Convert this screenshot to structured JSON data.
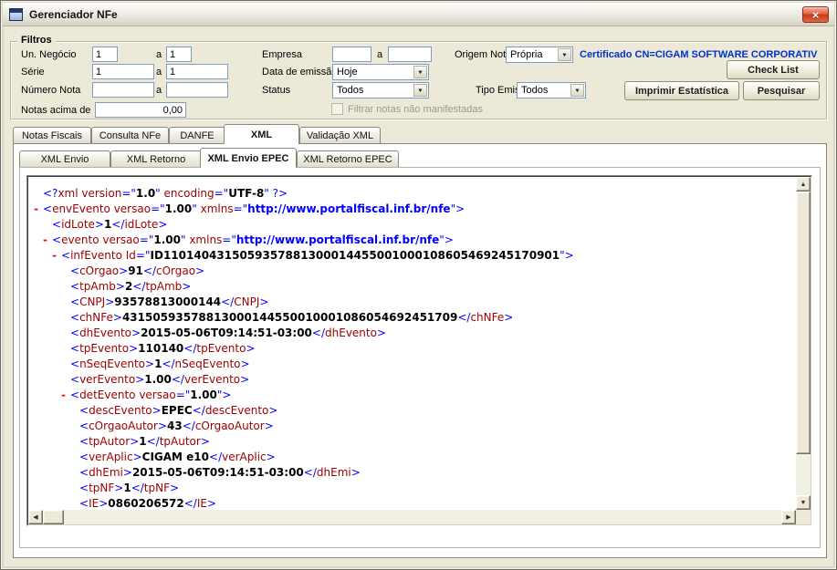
{
  "window": {
    "title": "Gerenciador NFe"
  },
  "icons": {
    "close": "×",
    "dropdown": "▼",
    "scroll_up": "▲",
    "scroll_down": "▼",
    "scroll_left": "◀",
    "scroll_right": "▶",
    "collapse": "-"
  },
  "colors": {
    "certificate_text": "#0033cc",
    "xml_markup": "#0000ff",
    "xml_tag": "#990000",
    "xml_text": "#000000",
    "xml_url": "#0000ff",
    "xml_marker": "#ff0000"
  },
  "filters": {
    "group_label": "Filtros",
    "range_sep": "a",
    "un_negocio_label": "Un. Negócio",
    "un_negocio_from": "1",
    "un_negocio_to": "1",
    "serie_label": "Série",
    "serie_from": "1",
    "serie_to": "1",
    "numero_label": "Número Nota",
    "numero_from": "",
    "numero_to": "",
    "notas_acima_label": "Notas acima de",
    "notas_acima_value": "0,00",
    "empresa_label": "Empresa",
    "empresa_from": "",
    "empresa_to": "",
    "data_emissao_label": "Data de emissão",
    "data_emissao_value": "Hoje",
    "status_label": "Status",
    "status_value": "Todos",
    "origem_label": "Origem Nota",
    "origem_value": "Própria",
    "tipo_emissao_label": "Tipo Emissão",
    "tipo_emissao_value": "Todos",
    "certificate_text": "Certificado CN=CIGAM SOFTWARE CORPORATIV",
    "manifest_checkbox_label": "Filtrar notas não manifestadas",
    "check_list_button": "Check List",
    "imprimir_button": "Imprimir Estatística",
    "pesquisar_button": "Pesquisar"
  },
  "tabs": {
    "main": [
      {
        "label": "Notas Fiscais"
      },
      {
        "label": "Consulta NFe"
      },
      {
        "label": "DANFE"
      },
      {
        "label": "XML",
        "active": true
      },
      {
        "label": "Validação XML"
      }
    ],
    "inner": [
      {
        "label": "XML Envio"
      },
      {
        "label": "XML Retorno"
      },
      {
        "label": "XML Envio EPEC",
        "active": true
      },
      {
        "label": "XML Retorno EPEC"
      }
    ]
  },
  "xml_viewer": {
    "lines": [
      {
        "lvl": 0,
        "mark": false,
        "seg": [
          [
            "m",
            "<?"
          ],
          [
            "t",
            "xml"
          ],
          [
            "t",
            " version"
          ],
          [
            "m",
            "=\""
          ],
          [
            "x",
            "1.0"
          ],
          [
            "m",
            "\""
          ],
          [
            "t",
            " encoding"
          ],
          [
            "m",
            "=\""
          ],
          [
            "x",
            "UTF-8"
          ],
          [
            "m",
            "\""
          ],
          [
            "m",
            " ?>"
          ]
        ]
      },
      {
        "lvl": 0,
        "mark": true,
        "seg": [
          [
            "m",
            "<"
          ],
          [
            "t",
            "envEvento"
          ],
          [
            "t",
            " versao"
          ],
          [
            "m",
            "=\""
          ],
          [
            "x",
            "1.00"
          ],
          [
            "m",
            "\""
          ],
          [
            "t",
            " xmlns"
          ],
          [
            "m",
            "=\""
          ],
          [
            "u",
            "http://www.portalfiscal.inf.br/nfe"
          ],
          [
            "m",
            "\""
          ],
          [
            "m",
            ">"
          ]
        ]
      },
      {
        "lvl": 1,
        "mark": false,
        "seg": [
          [
            "m",
            "<"
          ],
          [
            "t",
            "idLote"
          ],
          [
            "m",
            ">"
          ],
          [
            "x",
            "1"
          ],
          [
            "m",
            "</"
          ],
          [
            "t",
            "idLote"
          ],
          [
            "m",
            ">"
          ]
        ]
      },
      {
        "lvl": 1,
        "mark": true,
        "seg": [
          [
            "m",
            "<"
          ],
          [
            "t",
            "evento"
          ],
          [
            "t",
            " versao"
          ],
          [
            "m",
            "=\""
          ],
          [
            "x",
            "1.00"
          ],
          [
            "m",
            "\""
          ],
          [
            "t",
            " xmlns"
          ],
          [
            "m",
            "=\""
          ],
          [
            "u",
            "http://www.portalfiscal.inf.br/nfe"
          ],
          [
            "m",
            "\""
          ],
          [
            "m",
            ">"
          ]
        ]
      },
      {
        "lvl": 2,
        "mark": true,
        "seg": [
          [
            "m",
            "<"
          ],
          [
            "t",
            "infEvento"
          ],
          [
            "t",
            " Id"
          ],
          [
            "m",
            "=\""
          ],
          [
            "x",
            "ID1101404315059357881300014455001000108605469245170901"
          ],
          [
            "m",
            "\""
          ],
          [
            "m",
            ">"
          ]
        ]
      },
      {
        "lvl": 3,
        "mark": false,
        "seg": [
          [
            "m",
            "<"
          ],
          [
            "t",
            "cOrgao"
          ],
          [
            "m",
            ">"
          ],
          [
            "x",
            "91"
          ],
          [
            "m",
            "</"
          ],
          [
            "t",
            "cOrgao"
          ],
          [
            "m",
            ">"
          ]
        ]
      },
      {
        "lvl": 3,
        "mark": false,
        "seg": [
          [
            "m",
            "<"
          ],
          [
            "t",
            "tpAmb"
          ],
          [
            "m",
            ">"
          ],
          [
            "x",
            "2"
          ],
          [
            "m",
            "</"
          ],
          [
            "t",
            "tpAmb"
          ],
          [
            "m",
            ">"
          ]
        ]
      },
      {
        "lvl": 3,
        "mark": false,
        "seg": [
          [
            "m",
            "<"
          ],
          [
            "t",
            "CNPJ"
          ],
          [
            "m",
            ">"
          ],
          [
            "x",
            "93578813000144"
          ],
          [
            "m",
            "</"
          ],
          [
            "t",
            "CNPJ"
          ],
          [
            "m",
            ">"
          ]
        ]
      },
      {
        "lvl": 3,
        "mark": false,
        "seg": [
          [
            "m",
            "<"
          ],
          [
            "t",
            "chNFe"
          ],
          [
            "m",
            ">"
          ],
          [
            "x",
            "43150593578813000144550010001086054692451709"
          ],
          [
            "m",
            "</"
          ],
          [
            "t",
            "chNFe"
          ],
          [
            "m",
            ">"
          ]
        ]
      },
      {
        "lvl": 3,
        "mark": false,
        "seg": [
          [
            "m",
            "<"
          ],
          [
            "t",
            "dhEvento"
          ],
          [
            "m",
            ">"
          ],
          [
            "x",
            "2015-05-06T09:14:51-03:00"
          ],
          [
            "m",
            "</"
          ],
          [
            "t",
            "dhEvento"
          ],
          [
            "m",
            ">"
          ]
        ]
      },
      {
        "lvl": 3,
        "mark": false,
        "seg": [
          [
            "m",
            "<"
          ],
          [
            "t",
            "tpEvento"
          ],
          [
            "m",
            ">"
          ],
          [
            "x",
            "110140"
          ],
          [
            "m",
            "</"
          ],
          [
            "t",
            "tpEvento"
          ],
          [
            "m",
            ">"
          ]
        ]
      },
      {
        "lvl": 3,
        "mark": false,
        "seg": [
          [
            "m",
            "<"
          ],
          [
            "t",
            "nSeqEvento"
          ],
          [
            "m",
            ">"
          ],
          [
            "x",
            "1"
          ],
          [
            "m",
            "</"
          ],
          [
            "t",
            "nSeqEvento"
          ],
          [
            "m",
            ">"
          ]
        ]
      },
      {
        "lvl": 3,
        "mark": false,
        "seg": [
          [
            "m",
            "<"
          ],
          [
            "t",
            "verEvento"
          ],
          [
            "m",
            ">"
          ],
          [
            "x",
            "1.00"
          ],
          [
            "m",
            "</"
          ],
          [
            "t",
            "verEvento"
          ],
          [
            "m",
            ">"
          ]
        ]
      },
      {
        "lvl": 3,
        "mark": true,
        "seg": [
          [
            "m",
            "<"
          ],
          [
            "t",
            "detEvento"
          ],
          [
            "t",
            " versao"
          ],
          [
            "m",
            "=\""
          ],
          [
            "x",
            "1.00"
          ],
          [
            "m",
            "\""
          ],
          [
            "m",
            ">"
          ]
        ]
      },
      {
        "lvl": 4,
        "mark": false,
        "seg": [
          [
            "m",
            "<"
          ],
          [
            "t",
            "descEvento"
          ],
          [
            "m",
            ">"
          ],
          [
            "x",
            "EPEC"
          ],
          [
            "m",
            "</"
          ],
          [
            "t",
            "descEvento"
          ],
          [
            "m",
            ">"
          ]
        ]
      },
      {
        "lvl": 4,
        "mark": false,
        "seg": [
          [
            "m",
            "<"
          ],
          [
            "t",
            "cOrgaoAutor"
          ],
          [
            "m",
            ">"
          ],
          [
            "x",
            "43"
          ],
          [
            "m",
            "</"
          ],
          [
            "t",
            "cOrgaoAutor"
          ],
          [
            "m",
            ">"
          ]
        ]
      },
      {
        "lvl": 4,
        "mark": false,
        "seg": [
          [
            "m",
            "<"
          ],
          [
            "t",
            "tpAutor"
          ],
          [
            "m",
            ">"
          ],
          [
            "x",
            "1"
          ],
          [
            "m",
            "</"
          ],
          [
            "t",
            "tpAutor"
          ],
          [
            "m",
            ">"
          ]
        ]
      },
      {
        "lvl": 4,
        "mark": false,
        "seg": [
          [
            "m",
            "<"
          ],
          [
            "t",
            "verAplic"
          ],
          [
            "m",
            ">"
          ],
          [
            "x",
            "CIGAM e10"
          ],
          [
            "m",
            "</"
          ],
          [
            "t",
            "verAplic"
          ],
          [
            "m",
            ">"
          ]
        ]
      },
      {
        "lvl": 4,
        "mark": false,
        "seg": [
          [
            "m",
            "<"
          ],
          [
            "t",
            "dhEmi"
          ],
          [
            "m",
            ">"
          ],
          [
            "x",
            "2015-05-06T09:14:51-03:00"
          ],
          [
            "m",
            "</"
          ],
          [
            "t",
            "dhEmi"
          ],
          [
            "m",
            ">"
          ]
        ]
      },
      {
        "lvl": 4,
        "mark": false,
        "seg": [
          [
            "m",
            "<"
          ],
          [
            "t",
            "tpNF"
          ],
          [
            "m",
            ">"
          ],
          [
            "x",
            "1"
          ],
          [
            "m",
            "</"
          ],
          [
            "t",
            "tpNF"
          ],
          [
            "m",
            ">"
          ]
        ]
      },
      {
        "lvl": 4,
        "mark": false,
        "seg": [
          [
            "m",
            "<"
          ],
          [
            "t",
            "IE"
          ],
          [
            "m",
            ">"
          ],
          [
            "x",
            "0860206572"
          ],
          [
            "m",
            "</"
          ],
          [
            "t",
            "IE"
          ],
          [
            "m",
            ">"
          ]
        ]
      }
    ]
  }
}
